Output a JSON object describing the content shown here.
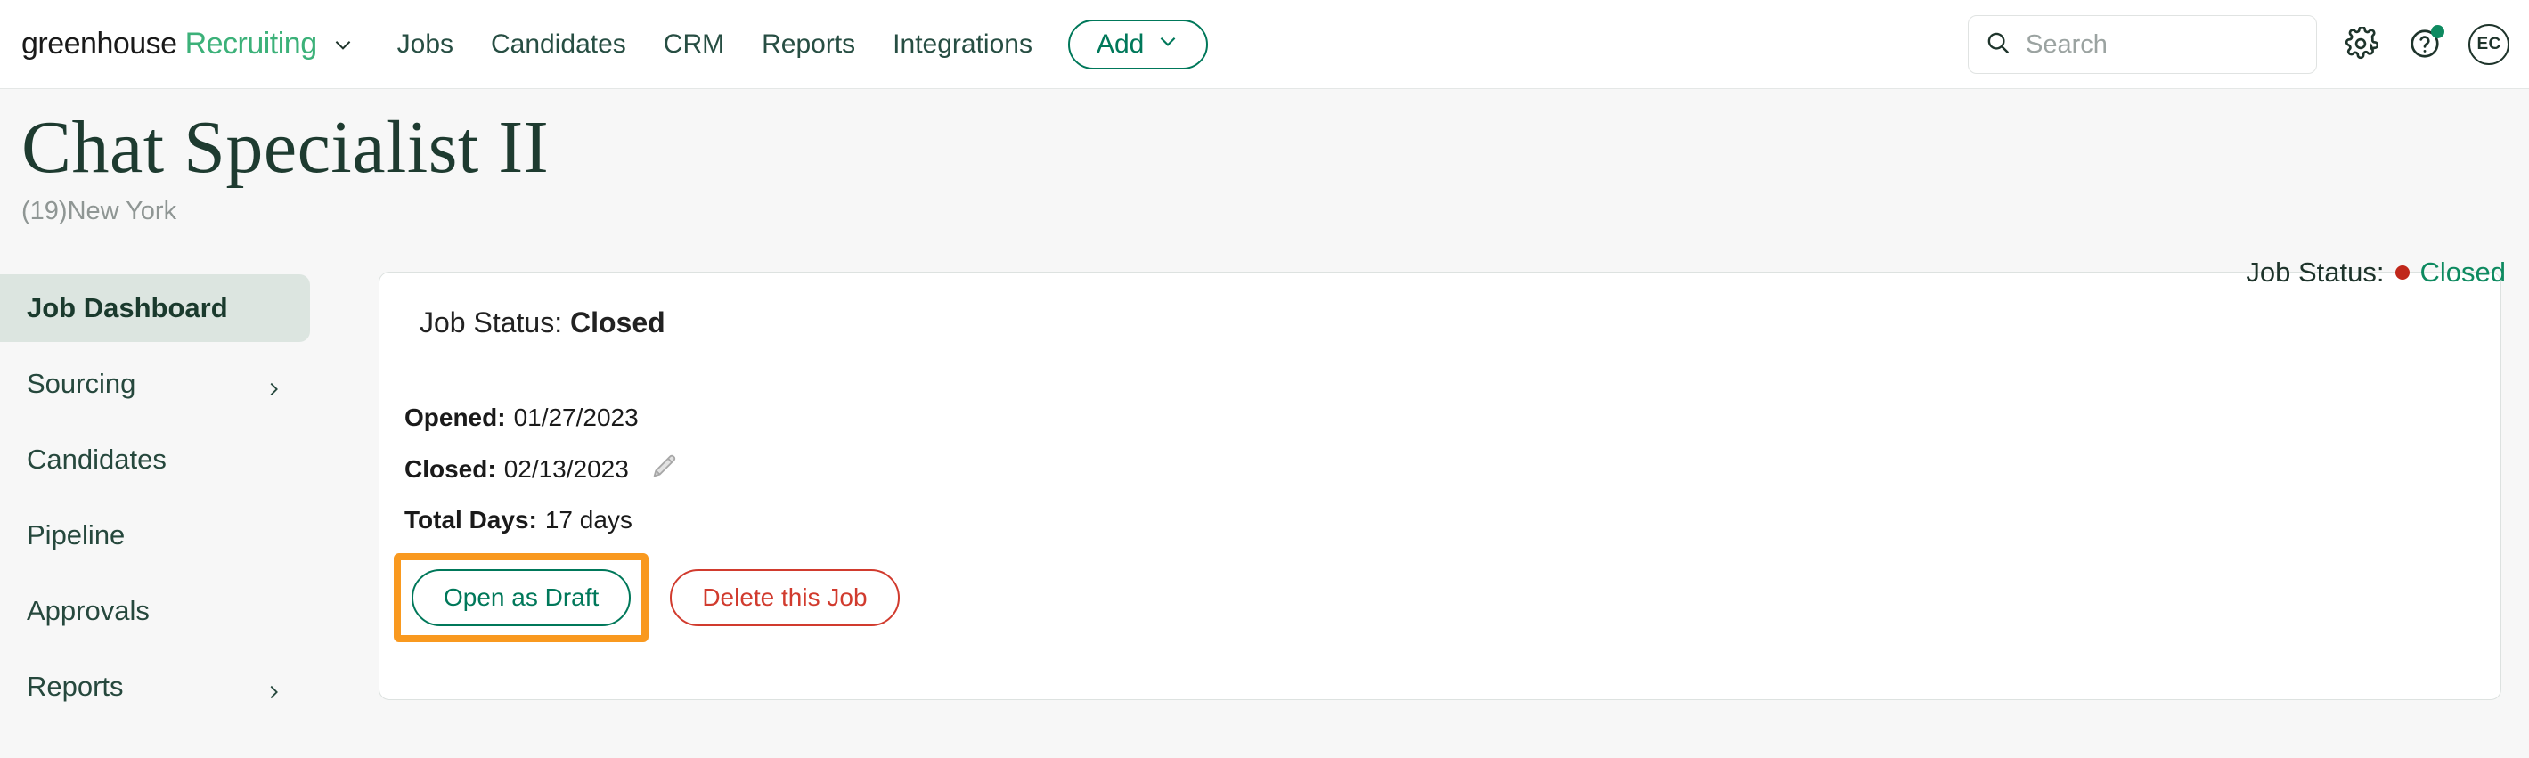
{
  "navbar": {
    "brand": {
      "name": "greenhouse",
      "product": "Recruiting",
      "caret_icon": "chevron-down-icon"
    },
    "links": [
      {
        "label": "Jobs"
      },
      {
        "label": "Candidates"
      },
      {
        "label": "CRM"
      },
      {
        "label": "Reports"
      },
      {
        "label": "Integrations"
      }
    ],
    "add_button": {
      "label": "Add",
      "caret_icon": "chevron-down-icon"
    },
    "search": {
      "placeholder": "Search",
      "value": "",
      "icon": "search-icon"
    },
    "settings_icon": "gear-icon",
    "help_icon": "question-circle-icon",
    "avatar": {
      "initials": "EC"
    }
  },
  "header": {
    "title": "Chat Specialist II",
    "subtitle": "(19)New York",
    "status_label": "Job Status:",
    "status_value": "Closed",
    "status_dot_color": "#C0271A",
    "status_value_color": "#0E8A60"
  },
  "sidebar": {
    "items": [
      {
        "label": "Job Dashboard",
        "active": true,
        "has_chevron": false
      },
      {
        "label": "Sourcing",
        "active": false,
        "has_chevron": true
      },
      {
        "label": "Candidates",
        "active": false,
        "has_chevron": false
      },
      {
        "label": "Pipeline",
        "active": false,
        "has_chevron": false
      },
      {
        "label": "Approvals",
        "active": false,
        "has_chevron": false
      },
      {
        "label": "Reports",
        "active": false,
        "has_chevron": true
      }
    ]
  },
  "card": {
    "status_label": "Job Status:",
    "status_value": "Closed",
    "details": [
      {
        "label": "Opened:",
        "value": "01/27/2023",
        "edit_icon": false
      },
      {
        "label": "Closed:",
        "value": "02/13/2023",
        "edit_icon": true
      },
      {
        "label": "Total Days:",
        "value": "17 days",
        "edit_icon": false
      }
    ],
    "open_as_draft_label": "Open as Draft",
    "delete_job_label": "Delete this Job"
  },
  "annotation": {
    "highlight_color": "#F9991F",
    "target": "Open as Draft"
  }
}
